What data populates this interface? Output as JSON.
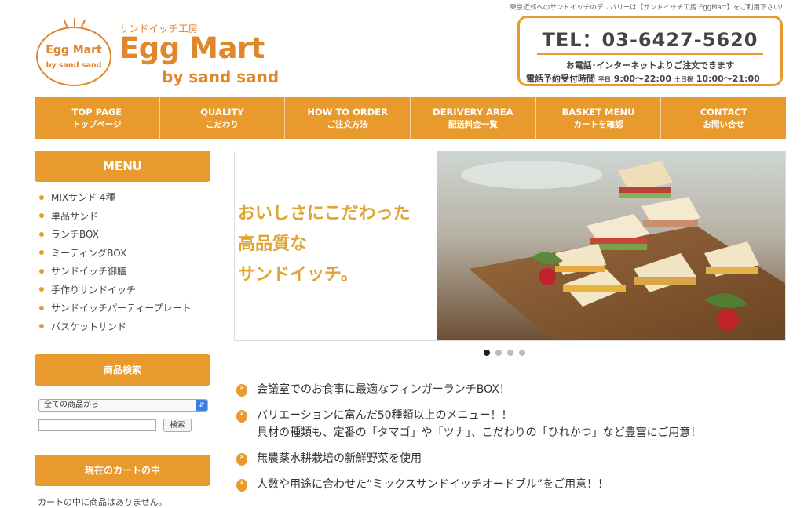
{
  "header": {
    "tagline": "東京近郊へのサンドイッチのデリバリーは【サンドイッチ工房 EggMart】をご利用下さい！",
    "logo_oval_line1": "Egg Mart",
    "logo_oval_line2": "by sand sand",
    "logo_sub": "サンドイッチ工房",
    "logo_main": "Egg Mart",
    "logo_by": "by sand sand",
    "tel": "TEL：03-6427-5620",
    "tel_note": "お電話･インターネットよりご注文できます",
    "hours_label": "電話予約受付時間",
    "weekday_label": "平日",
    "weekday_hours": "9:00～22:00",
    "weekend_label": "土日祝",
    "weekend_hours": "10:00～21:00"
  },
  "nav": [
    {
      "en": "TOP PAGE",
      "ja": "トップページ"
    },
    {
      "en": "QUALITY",
      "ja": "こだわり"
    },
    {
      "en": "HOW TO ORDER",
      "ja": "ご注文方法"
    },
    {
      "en": "DERIVERY AREA",
      "ja": "配送料金一覧"
    },
    {
      "en": "BASKET MENU",
      "ja": "カートを確認"
    },
    {
      "en": "CONTACT",
      "ja": "お問い合せ"
    }
  ],
  "sidebar": {
    "menu_title": "MENU",
    "menu_items": [
      "MIXサンド 4種",
      "単品サンド",
      "ランチBOX",
      "ミーティングBOX",
      "サンドイッチ御膳",
      "手作りサンドイッチ",
      "サンドイッチパーティープレート",
      "バスケットサンド"
    ],
    "search_title": "商品検索",
    "search_select_value": "全ての商品から",
    "search_button": "検索",
    "cart_title": "現在のカートの中",
    "cart_empty": "カートの中に商品はありません。"
  },
  "hero": {
    "line1": "おいしさにこだわった",
    "line2": "高品質な",
    "line3": "サンドイッチ。",
    "slide_count": 4,
    "active_slide": 1
  },
  "features": [
    {
      "line1": "会議室でのお食事に最適なフィンガーランチBOX！"
    },
    {
      "line1": "バリエーションに富んだ50種類以上のメニュー！！",
      "line2": "具材の種類も、定番の「タマゴ」や「ツナ」、こだわりの「ひれかつ」など豊富にご用意！"
    },
    {
      "line1": "無農薬水耕栽培の新鮮野菜を使用"
    },
    {
      "line1": "人数や用途に合わせた“ミックスサンドイッチオードブル”をご用意！！"
    }
  ],
  "colors": {
    "accent": "#e89a2c",
    "hero_text": "#e0a531"
  }
}
